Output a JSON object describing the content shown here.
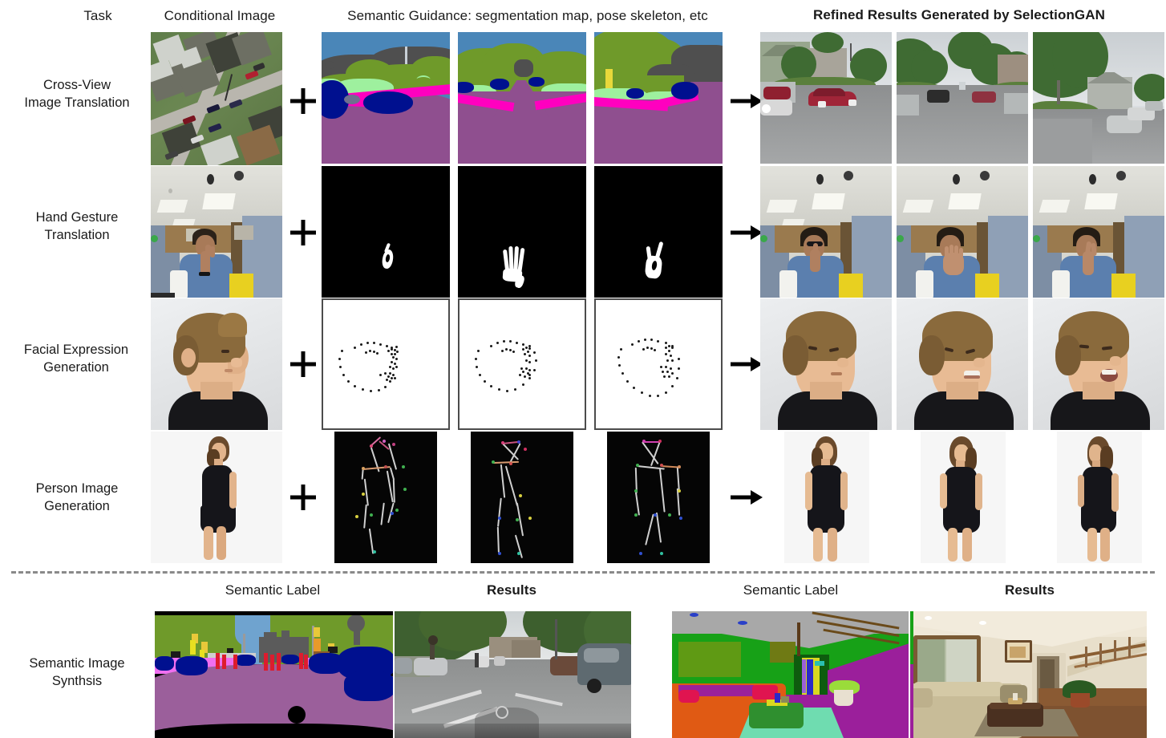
{
  "figure": {
    "headers": {
      "task": "Task",
      "conditional_image": "Conditional Image",
      "semantic_guidance": "Semantic Guidance: segmentation map, pose skeleton, etc",
      "refined_results": "Refined Results Generated by SelectionGAN"
    },
    "operators": {
      "plus": "+",
      "arrow": "→"
    },
    "rows": [
      {
        "task_label": "Cross-View\nImage Translation",
        "conditional_image": "aerial-view-photo",
        "guidance_type": "segmentation map",
        "guidance": [
          "segmentation-map-1",
          "segmentation-map-2",
          "segmentation-map-3"
        ],
        "results": [
          "street-view-result-1",
          "street-view-result-2",
          "street-view-result-3"
        ]
      },
      {
        "task_label": "Hand Gesture\nTranslation",
        "conditional_image": "office-person-photo",
        "guidance_type": "hand mask",
        "guidance": [
          "hand-mask-1",
          "hand-mask-2",
          "hand-mask-3"
        ],
        "results": [
          "hand-gesture-result-1",
          "hand-gesture-result-2",
          "hand-gesture-result-3"
        ]
      },
      {
        "task_label": "Facial Expression\nGeneration",
        "conditional_image": "face-profile-photo",
        "guidance_type": "facial landmarks",
        "guidance": [
          "landmark-map-1",
          "landmark-map-2",
          "landmark-map-3"
        ],
        "results": [
          "face-expression-result-1",
          "face-expression-result-2",
          "face-expression-result-3"
        ]
      },
      {
        "task_label": "Person Image\nGeneration",
        "conditional_image": "person-dress-photo",
        "guidance_type": "pose skeleton",
        "guidance": [
          "pose-skeleton-1",
          "pose-skeleton-2",
          "pose-skeleton-3"
        ],
        "results": [
          "person-pose-result-1",
          "person-pose-result-2",
          "person-pose-result-3"
        ]
      }
    ],
    "bottom": {
      "task_label": "Semantic Image\nSynthsis",
      "groups": [
        {
          "label_semantic": "Semantic Label",
          "label_results": "Results",
          "semantic_image": "cityscapes-segmentation-map",
          "result_image": "cityscapes-street-photo"
        },
        {
          "label_semantic": "Semantic Label",
          "label_results": "Results",
          "semantic_image": "indoor-segmentation-map",
          "result_image": "living-room-photo"
        }
      ]
    },
    "colors": {
      "background": "#ffffff",
      "text": "#1a1a1a",
      "separator": "#8a8a8a",
      "image_border": "#4c4c4c",
      "seg_sky": "#4a86b8",
      "seg_vegetation": "#6f9a2a",
      "seg_building": "#4f4f4f",
      "seg_road": "#8f4f8f",
      "seg_sidewalk": "#9ef09e",
      "seg_car": "#00108f",
      "seg_pink": "#ff00bf"
    }
  }
}
